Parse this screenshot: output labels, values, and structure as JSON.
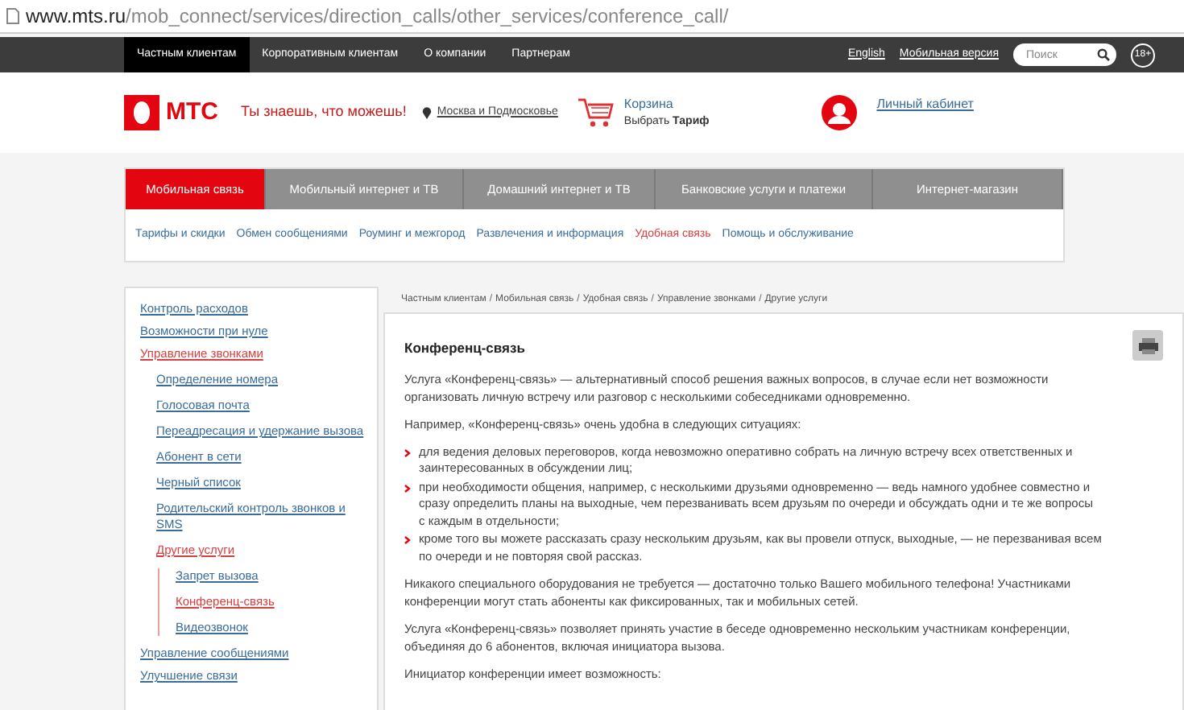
{
  "address_bar": {
    "host": "www.mts.ru",
    "path": "/mob_connect/services/direction_calls/other_services/conference_call/"
  },
  "top_bar": {
    "items": [
      {
        "label": "Частным клиентам",
        "selected": true
      },
      {
        "label": "Корпоративным клиентам",
        "selected": false
      },
      {
        "label": "О компании",
        "selected": false
      },
      {
        "label": "Партнерам",
        "selected": false
      }
    ],
    "links": [
      "English",
      "Мобильная версия"
    ],
    "search": {
      "placeholder": "Поиск"
    },
    "age_badge": "18+"
  },
  "header": {
    "logo": "МТС",
    "slogan": "Ты знаешь, что можешь!",
    "region": "Москва и Подмосковье",
    "cart": {
      "title": "Корзина",
      "subtitle": "Выбрать **Тариф**"
    },
    "account": "Личный кабинет"
  },
  "main_nav": [
    {
      "label": "Мобильная связь",
      "selected": true
    },
    {
      "label": "Мобильный интернет и ТВ",
      "selected": false
    },
    {
      "label": "Домашний интернет и ТВ",
      "selected": false
    },
    {
      "label": "Банковские услуги и платежи",
      "selected": false
    },
    {
      "label": "Интернет-магазин",
      "selected": false
    }
  ],
  "sub_nav": [
    {
      "label": "Тарифы и скидки",
      "selected": false
    },
    {
      "label": "Обмен сообщениями",
      "selected": false
    },
    {
      "label": "Роуминг и межгород",
      "selected": false
    },
    {
      "label": "Развлечения и информация",
      "selected": false
    },
    {
      "label": "Удобная связь",
      "selected": true
    },
    {
      "label": "Помощь и обслуживание",
      "selected": false
    }
  ],
  "sidebar": {
    "items": [
      {
        "label": "Контроль расходов",
        "selected": false
      },
      {
        "label": "Возможности при нуле",
        "selected": false
      },
      {
        "label": "Управление звонками",
        "selected": true,
        "children": [
          {
            "label": "Определение номера",
            "selected": false
          },
          {
            "label": "Голосовая почта",
            "selected": false
          },
          {
            "label": "Переадресация и удержание вызова",
            "selected": false
          },
          {
            "label": "Абонент в сети",
            "selected": false
          },
          {
            "label": "Черный список",
            "selected": false
          },
          {
            "label": "Родительский контроль звонков и SMS",
            "selected": false
          },
          {
            "label": "Другие услуги",
            "selected": true,
            "children": [
              {
                "label": "Запрет вызова",
                "selected": false
              },
              {
                "label": "Конференц-связь",
                "selected": true
              },
              {
                "label": "Видеозвонок",
                "selected": false
              }
            ]
          }
        ]
      },
      {
        "label": "Управление сообщениями",
        "selected": false
      },
      {
        "label": "Улучшение связи",
        "selected": false
      }
    ]
  },
  "breadcrumb_separator": "/",
  "breadcrumbs": [
    "Частным клиентам",
    "Мобильная связь",
    "Удобная связь",
    "Управление звонками",
    "Другие услуги"
  ],
  "article": {
    "title": "Конференц-связь",
    "blocks": [
      {
        "kind": "paragraph",
        "text": "Услуга «Конференц-связь» — альтернативный способ решения важных вопросов, в случае если нет возможности организовать личную встречу или разговор с несколькими собеседниками одновременно."
      },
      {
        "kind": "paragraph",
        "text": "Например, «Конференц-связь» очень удобна в следующих ситуациях:"
      },
      {
        "kind": "list",
        "items": [
          "для ведения деловых переговоров, когда невозможно оперативно собрать на личную встречу всех ответственных и заинтересованных в обсуждении лиц;",
          "при необходимости общения, например, с несколькими друзьями одновременно — ведь намного удобнее совместно и сразу определить планы на выходные, чем перезванивать всем друзьям по очереди и обсуждать одни и те же вопросы с каждым в отдельности;",
          "кроме того вы можете рассказать сразу нескольким друзьям, как вы провели отпуск, выходные, — не перезванивая всем по очереди и не повторяя свой рассказ."
        ]
      },
      {
        "kind": "paragraph",
        "text": "Никакого специального оборудования не требуется — достаточно только Вашего мобильного телефона! Участниками конференции могут стать абоненты как фиксированных, так и мобильных сетей."
      },
      {
        "kind": "paragraph",
        "text": "Услуга «Конференц-связь» позволяет принять участие в беседе одновременно нескольким участникам конференции, объединяя до 6 абонентов, включая инициатора вызова."
      },
      {
        "kind": "paragraph",
        "text": "Инициатор конференции имеет возможность:"
      }
    ]
  }
}
